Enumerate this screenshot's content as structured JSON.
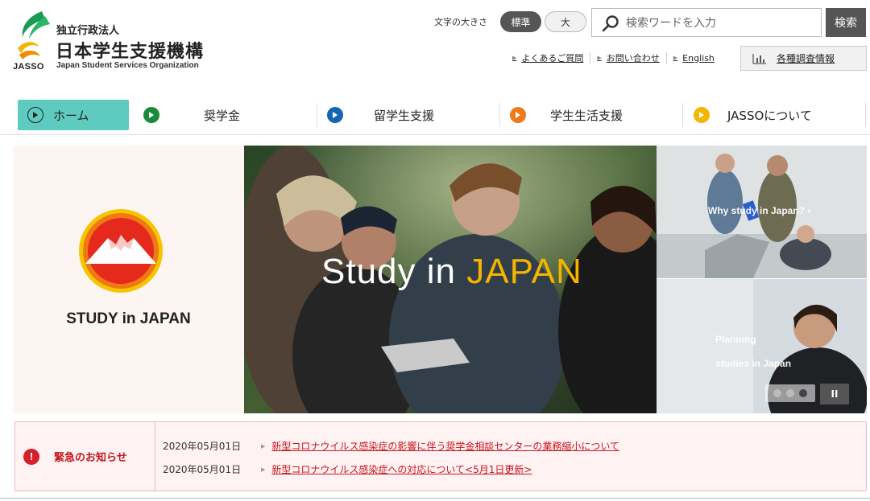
{
  "header": {
    "logo_mark_text": "JASSO",
    "org_type": "独立行政法人",
    "org_name": "日本学生支援機構",
    "org_name_en": "Japan Student Services Organization",
    "font_size_label": "文字の大きさ",
    "font_size_standard": "標準",
    "font_size_large": "大",
    "search_placeholder": "検索ワードを入力",
    "search_button": "検索",
    "util_links": [
      "よくあるご質問",
      "お問い合わせ",
      "English"
    ],
    "survey_label": "各種調査情報"
  },
  "nav": {
    "items": [
      {
        "label": "ホーム",
        "color": "#222222"
      },
      {
        "label": "奨学金",
        "color": "#1a8a3b"
      },
      {
        "label": "留学生支援",
        "color": "#1565b6"
      },
      {
        "label": "学生生活支援",
        "color": "#ef7a1a"
      },
      {
        "label": "JASSOについて",
        "color": "#f4b400"
      }
    ],
    "active_color": "#5fcbc0"
  },
  "hero": {
    "left_caption": "STUDY in JAPAN",
    "main_title_prefix": "Study in ",
    "main_title_accent": "JAPAN",
    "panel_top_text": "Why study in Japan?",
    "panel_top_arrow": "›",
    "panel_bottom_text_1": "Planning",
    "panel_bottom_text_2": "studies in Japan",
    "pause_label": "II",
    "slide_count": 3,
    "active_slide": 3
  },
  "alert": {
    "title": "緊急のお知らせ",
    "icon_text": "!",
    "items": [
      {
        "date": "2020年05月01日",
        "text": "新型コロナウイルス感染症の影響に伴う奨学金相談センターの業務縮小について"
      },
      {
        "date": "2020年05月01日",
        "text": "新型コロナウイルス感染症への対応について<5月1日更新>"
      }
    ],
    "accent_color": "#c5161d"
  }
}
